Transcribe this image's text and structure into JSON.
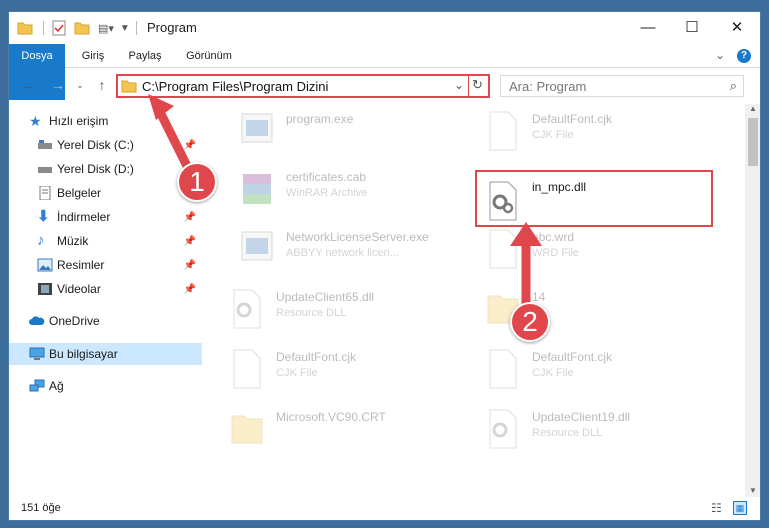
{
  "window": {
    "title": "Program",
    "controls": {
      "minimize": "—",
      "maximize": "☐",
      "close": "✕"
    }
  },
  "ribbon": {
    "tabs": [
      {
        "label": "Dosya"
      },
      {
        "label": "Giriş"
      },
      {
        "label": "Paylaş"
      },
      {
        "label": "Görünüm"
      }
    ],
    "help": "?"
  },
  "address": {
    "path": "C:\\Program Files\\Program Dizini",
    "search_placeholder": "Ara: Program"
  },
  "sidebar": {
    "items": [
      {
        "label": "Hızlı erişim",
        "icon": "star-icon"
      },
      {
        "label": "Yerel Disk (C:)",
        "icon": "drive-icon"
      },
      {
        "label": "Yerel Disk (D:)",
        "icon": "drive-icon"
      },
      {
        "label": "Belgeler",
        "icon": "documents-icon"
      },
      {
        "label": "İndirmeler",
        "icon": "download-icon"
      },
      {
        "label": "Müzik",
        "icon": "music-icon"
      },
      {
        "label": "Resimler",
        "icon": "pictures-icon"
      },
      {
        "label": "Videolar",
        "icon": "video-icon"
      },
      {
        "label": "OneDrive",
        "icon": "cloud-icon"
      },
      {
        "label": "Bu bilgisayar",
        "icon": "computer-icon"
      },
      {
        "label": "Ağ",
        "icon": "network-icon"
      }
    ]
  },
  "files": [
    {
      "name": "program.exe",
      "type": "",
      "icon": "exe-icon"
    },
    {
      "name": "DefaultFont.cjk",
      "type": "CJK File",
      "icon": "blank-file-icon"
    },
    {
      "name": "certificates.cab",
      "type": "WinRAR Archive",
      "icon": "archive-icon"
    },
    {
      "name": "in_mpc.dll",
      "type": "",
      "icon": "dll-gear-icon"
    },
    {
      "name": "NetworkLicenseServer.exe",
      "type": "ABBYY network licen...",
      "icon": "exe-icon"
    },
    {
      "name": "abc.wrd",
      "type": "WRD File",
      "icon": "blank-file-icon"
    },
    {
      "name": "UpdateClient65.dll",
      "type": "Resource DLL",
      "icon": "dll-gear-icon"
    },
    {
      "name": "14",
      "type": "",
      "icon": "folder-icon"
    },
    {
      "name": "DefaultFont.cjk",
      "type": "CJK File",
      "icon": "blank-file-icon"
    },
    {
      "name": "DefaultFont.cjk",
      "type": "CJK File",
      "icon": "blank-file-icon"
    },
    {
      "name": "Microsoft.VC90.CRT",
      "type": "",
      "icon": "folder-icon"
    },
    {
      "name": "UpdateClient19.dll",
      "type": "Resource DLL",
      "icon": "dll-gear-icon"
    }
  ],
  "status": {
    "count": "151 öğe"
  },
  "annotations": {
    "step1": "1",
    "step2": "2"
  },
  "colors": {
    "accent": "#1979ca",
    "highlight": "#e0474c",
    "selection": "#cce8ff"
  }
}
